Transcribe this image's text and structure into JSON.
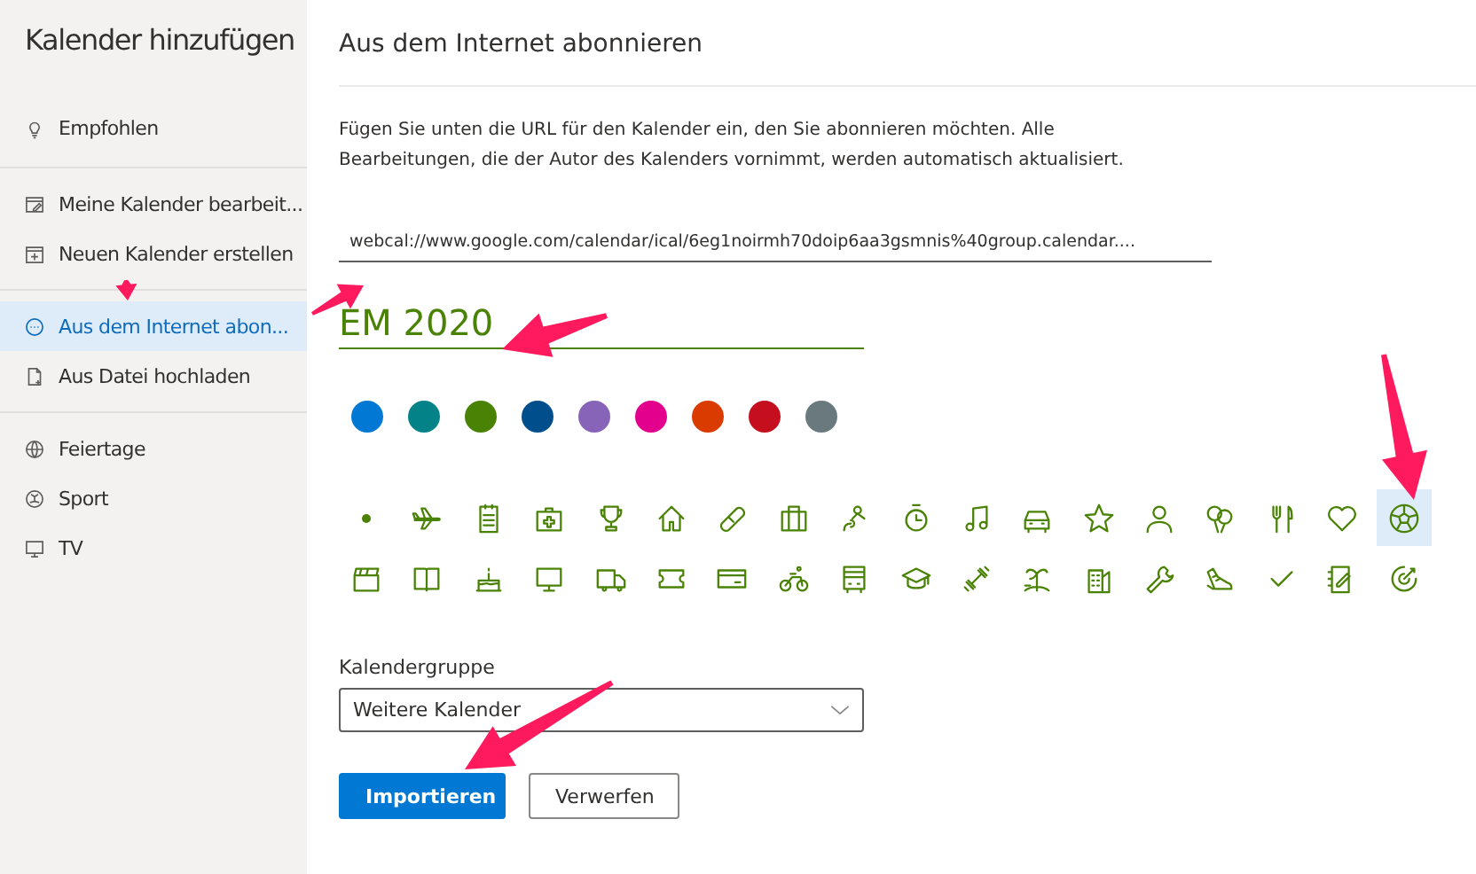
{
  "sidebar": {
    "title": "Kalender hinzufügen",
    "groups": [
      {
        "items": [
          {
            "label": "Empfohlen",
            "selected": false
          }
        ]
      },
      {
        "items": [
          {
            "label": "Meine Kalender bearbeit...",
            "selected": false
          },
          {
            "label": "Neuen Kalender erstellen",
            "selected": false
          }
        ]
      },
      {
        "items": [
          {
            "label": "Aus dem Internet abon...",
            "selected": true
          },
          {
            "label": "Aus Datei hochladen",
            "selected": false
          }
        ]
      },
      {
        "items": [
          {
            "label": "Feiertage",
            "selected": false
          },
          {
            "label": "Sport",
            "selected": false
          },
          {
            "label": "TV",
            "selected": false
          }
        ]
      }
    ]
  },
  "panel": {
    "title": "Aus dem Internet abonnieren",
    "description": "Fügen Sie unten die URL für den Kalender ein, den Sie abonnieren möchten. Alle Bearbeitungen, die der Autor des Kalenders vornimmt, werden automatisch aktualisiert.",
    "url": "webcal://www.google.com/calendar/ical/6eg1noirmh70doip6aa3gsmnis%40group.calendar....",
    "name": "EM 2020",
    "colors": [
      {
        "color": "#0078d4"
      },
      {
        "color": "#038387"
      },
      {
        "color": "#498205"
      },
      {
        "color": "#004e8c"
      },
      {
        "color": "#8764b8"
      },
      {
        "color": "#e3008c"
      },
      {
        "color": "#da3b01"
      },
      {
        "color": "#c50f1f"
      },
      {
        "color": "#69797e"
      }
    ],
    "icons": [
      {
        "selected": false
      },
      {
        "selected": false
      },
      {
        "selected": false
      },
      {
        "selected": false
      },
      {
        "selected": false
      },
      {
        "selected": false
      },
      {
        "selected": false
      },
      {
        "selected": false
      },
      {
        "selected": false
      },
      {
        "selected": false
      },
      {
        "selected": false
      },
      {
        "selected": false
      },
      {
        "selected": false
      },
      {
        "selected": false
      },
      {
        "selected": false
      },
      {
        "selected": false
      },
      {
        "selected": false
      },
      {
        "selected": true
      },
      {
        "selected": false
      },
      {
        "selected": false
      },
      {
        "selected": false
      },
      {
        "selected": false
      },
      {
        "selected": false
      },
      {
        "selected": false
      },
      {
        "selected": false
      },
      {
        "selected": false
      },
      {
        "selected": false
      },
      {
        "selected": false
      },
      {
        "selected": false
      },
      {
        "selected": false
      },
      {
        "selected": false
      },
      {
        "selected": false
      },
      {
        "selected": false
      },
      {
        "selected": false
      },
      {
        "selected": false
      },
      {
        "selected": false
      }
    ],
    "group_label": "Kalendergruppe",
    "group_value": "Weitere Kalender",
    "buttons": [
      {
        "label": "Importieren",
        "kind": "primary"
      },
      {
        "label": "Verwerfen",
        "kind": "secondary"
      }
    ]
  }
}
